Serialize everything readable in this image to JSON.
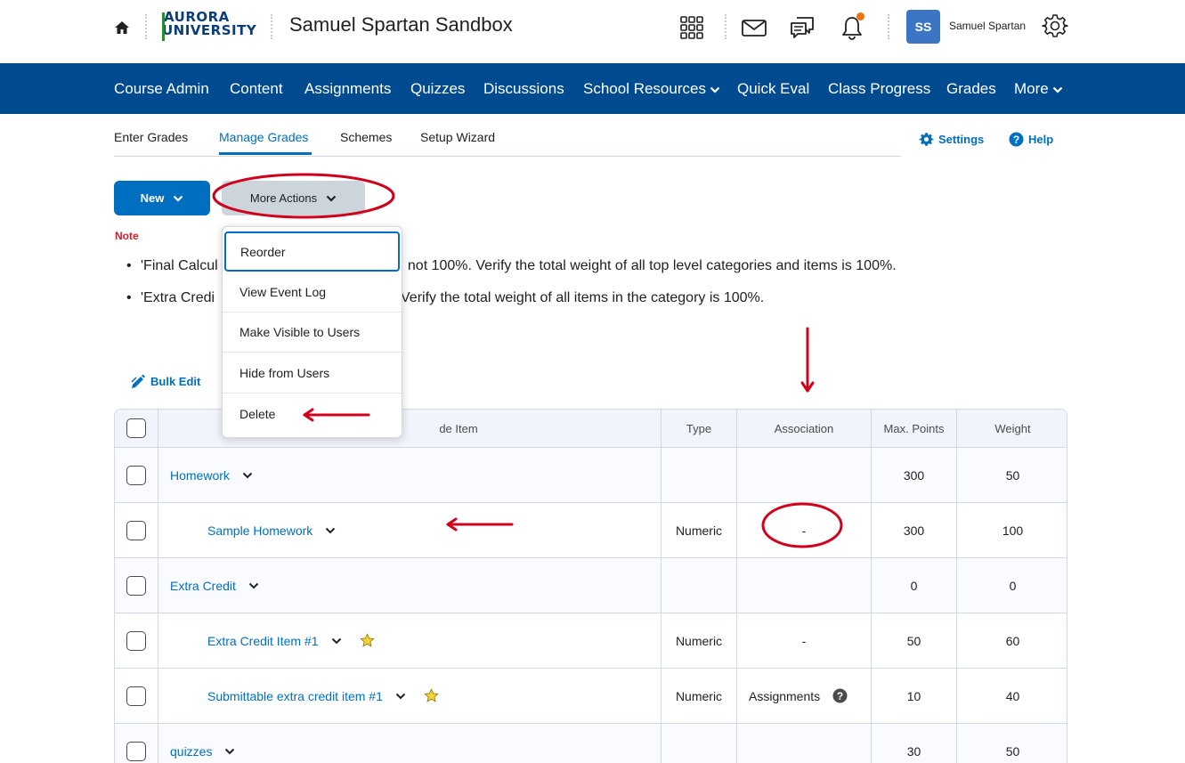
{
  "header": {
    "logo_line1": "AURORA",
    "logo_line2": "UNIVERSITY",
    "course_title": "Samuel Spartan Sandbox",
    "user_initials": "SS",
    "user_name": "Samuel Spartan",
    "icons": [
      "home-icon",
      "apps-grid-icon",
      "mail-icon",
      "chat-icon",
      "bell-icon",
      "gear-icon"
    ]
  },
  "navbar": {
    "items": [
      "Course Admin",
      "Content",
      "Assignments",
      "Quizzes",
      "Discussions",
      "School Resources",
      "Quick Eval",
      "Class Progress",
      "Grades",
      "More"
    ],
    "bg_color": "#004a8f"
  },
  "subtabs": {
    "items": [
      "Enter Grades",
      "Manage Grades",
      "Schemes",
      "Setup Wizard"
    ],
    "active": "Manage Grades",
    "settings_label": "Settings",
    "help_label": "Help"
  },
  "toolbar": {
    "new_label": "New",
    "more_actions_label": "More Actions"
  },
  "note": {
    "label": "Note",
    "line1_start": "'Final Calcul",
    "line1_end": ", not 100%. Verify the total weight of all top level categories and items is 100%.",
    "line2_start": "'Extra Credi",
    "line2_end": "Verify the total weight of all items in the category is 100%."
  },
  "dropdown": {
    "items": [
      "Reorder",
      "View Event Log",
      "Make Visible to Users",
      "Hide from Users",
      "Delete"
    ]
  },
  "bulk_edit_label": "Bulk Edit",
  "table": {
    "headers": {
      "grade_item": "de Item",
      "type": "Type",
      "association": "Association",
      "max_points": "Max. Points",
      "weight": "Weight"
    },
    "rows": [
      {
        "name": "Homework",
        "kind": "category",
        "type": "",
        "association": "",
        "max_points": "300",
        "weight": "50"
      },
      {
        "name": "Sample Homework",
        "kind": "item",
        "type": "Numeric",
        "association": "-",
        "max_points": "300",
        "weight": "100"
      },
      {
        "name": "Extra Credit",
        "kind": "category",
        "type": "",
        "association": "",
        "max_points": "0",
        "weight": "0"
      },
      {
        "name": "Extra Credit Item #1",
        "kind": "item",
        "bonus": true,
        "type": "Numeric",
        "association": "-",
        "max_points": "50",
        "weight": "60"
      },
      {
        "name": "Submittable extra credit item #1",
        "kind": "item",
        "bonus": true,
        "type": "Numeric",
        "association": "Assignments",
        "max_points": "10",
        "weight": "40"
      },
      {
        "name": "quizzes",
        "kind": "category",
        "type": "",
        "association": "",
        "max_points": "30",
        "weight": "50"
      }
    ]
  },
  "colors": {
    "accent": "#006fbf",
    "annotation_red": "#d0021b",
    "note_red": "#cd2026"
  }
}
